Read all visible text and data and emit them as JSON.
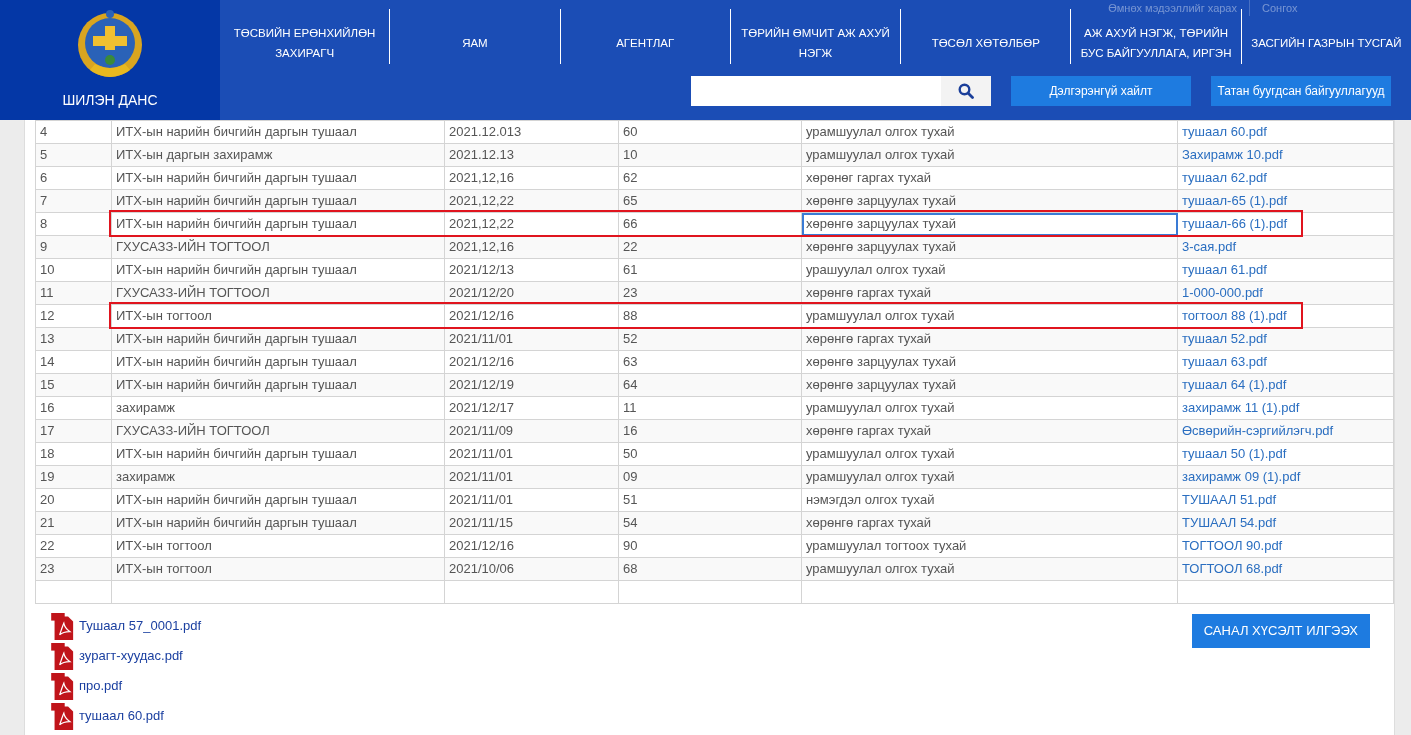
{
  "brand": {
    "title": "ШИЛЭН ДАНС"
  },
  "filter": {
    "label": "Өмнөх мэдээллийг харах",
    "select": "Сонгох"
  },
  "nav": [
    "ТӨСВИЙН ЕРӨНХИЙЛӨН ЗАХИРАГЧ",
    "ЯАМ",
    "АГЕНТЛАГ",
    "ТӨРИЙН ӨМЧИТ АЖ АХУЙ НЭГЖ",
    "ТӨСӨЛ ХӨТӨЛБӨР",
    "АЖ АХУЙ НЭГЖ, ТӨРИЙН БУС БАЙГУУЛЛАГА, ИРГЭН",
    "ЗАСГИЙН ГАЗРЫН ТУСГАЙ"
  ],
  "search": {
    "buttons": [
      "Дэлгэрэнгүй хайлт",
      "Татан буугдсан байгууллагууд"
    ]
  },
  "table": {
    "rows": [
      {
        "no": "4",
        "name": "ИТХ-ын нарийн бичгийн даргын тушаал",
        "date": "2021.12.013",
        "number": "60",
        "subject": "урамшуулал олгох тухай",
        "file": "тушаал 60.pdf",
        "marked": false,
        "focused": false
      },
      {
        "no": "5",
        "name": "ИТХ-ын даргын захирамж",
        "date": "2021.12.13",
        "number": "10",
        "subject": "урамшуулал олгох тухай",
        "file": "Захирамж 10.pdf",
        "marked": false,
        "focused": false
      },
      {
        "no": "6",
        "name": "ИТХ-ын нарийн бичгийн даргын тушаал",
        "date": "2021,12,16",
        "number": "62",
        "subject": "хөрөнөг гаргах тухай",
        "file": "тушаал 62.pdf",
        "marked": false,
        "focused": false
      },
      {
        "no": "7",
        "name": "ИТХ-ын нарийн бичгийн даргын тушаал",
        "date": "2021,12,22",
        "number": "65",
        "subject": "хөрөнгө зарцуулах тухай",
        "file": "тушаал-65 (1).pdf",
        "marked": false,
        "focused": false
      },
      {
        "no": "8",
        "name": "ИТХ-ын нарийн бичгийн даргын тушаал",
        "date": "2021,12,22",
        "number": "66",
        "subject": "хөрөнгө зарцуулах тухай",
        "file": "тушаал-66 (1).pdf",
        "marked": true,
        "focused": true
      },
      {
        "no": "9",
        "name": "ГХУСАЗЗ-ИЙН ТОГТООЛ",
        "date": "2021,12,16",
        "number": "22",
        "subject": "хөрөнгө зарцуулах тухай",
        "file": "3-сая.pdf",
        "marked": false,
        "focused": false
      },
      {
        "no": "10",
        "name": "ИТХ-ын нарийн бичгийн даргын тушаал",
        "date": "2021/12/13",
        "number": "61",
        "subject": "урашуулал олгох тухай",
        "file": "тушаал 61.pdf",
        "marked": false,
        "focused": false
      },
      {
        "no": "11",
        "name": "ГХУСАЗЗ-ИЙН ТОГТООЛ",
        "date": "2021/12/20",
        "number": "23",
        "subject": "хөрөнгө гаргах тухай",
        "file": "1-000-000.pdf",
        "marked": false,
        "focused": false
      },
      {
        "no": "12",
        "name": "ИТХ-ын тогтоол",
        "date": "2021/12/16",
        "number": "88",
        "subject": "урамшуулал олгох тухай",
        "file": "тогтоол 88 (1).pdf",
        "marked": true,
        "focused": false
      },
      {
        "no": "13",
        "name": "ИТХ-ын нарийн бичгийн даргын тушаал",
        "date": "2021/11/01",
        "number": "52",
        "subject": "хөрөнгө гаргах тухай",
        "file": "тушаал 52.pdf",
        "marked": false,
        "focused": false
      },
      {
        "no": "14",
        "name": "ИТХ-ын нарийн бичгийн даргын тушаал",
        "date": "2021/12/16",
        "number": "63",
        "subject": "хөрөнгө зарцуулах тухай",
        "file": "тушаал 63.pdf",
        "marked": false,
        "focused": false
      },
      {
        "no": "15",
        "name": "ИТХ-ын нарийн бичгийн даргын тушаал",
        "date": "2021/12/19",
        "number": "64",
        "subject": "хөрөнгө зарцуулах тухай",
        "file": "тушаал 64 (1).pdf",
        "marked": false,
        "focused": false
      },
      {
        "no": "16",
        "name": "захирамж",
        "date": "2021/12/17",
        "number": "11",
        "subject": "урамшуулал олгох тухай",
        "file": "захирамж 11 (1).pdf",
        "marked": false,
        "focused": false
      },
      {
        "no": "17",
        "name": "ГХУСАЗЗ-ИЙН ТОГТООЛ",
        "date": "2021/11/09",
        "number": "16",
        "subject": "хөрөнгө гаргах тухай",
        "file": "Өсвөрийн-сэргийлэгч.pdf",
        "marked": false,
        "focused": false
      },
      {
        "no": "18",
        "name": "ИТХ-ын нарийн бичгийн даргын тушаал",
        "date": "2021/11/01",
        "number": "50",
        "subject": "урамшуулал олгох тухай",
        "file": "тушаал 50 (1).pdf",
        "marked": false,
        "focused": false
      },
      {
        "no": "19",
        "name": "захирамж",
        "date": "2021/11/01",
        "number": "09",
        "subject": "урамшуулал олгох тухай",
        "file": "захирамж 09 (1).pdf",
        "marked": false,
        "focused": false
      },
      {
        "no": "20",
        "name": "ИТХ-ын нарийн бичгийн даргын тушаал",
        "date": "2021/11/01",
        "number": "51",
        "subject": "нэмэгдэл олгох тухай",
        "file": "ТУШААЛ 51.pdf",
        "marked": false,
        "focused": false
      },
      {
        "no": "21",
        "name": "ИТХ-ын нарийн бичгийн даргын тушаал",
        "date": "2021/11/15",
        "number": "54",
        "subject": "хөрөнгө гаргах тухай",
        "file": "ТУШААЛ 54.pdf",
        "marked": false,
        "focused": false
      },
      {
        "no": "22",
        "name": "ИТХ-ын тогтоол",
        "date": "2021/12/16",
        "number": "90",
        "subject": "урамшуулал тогтоох тухай",
        "file": "ТОГТООЛ 90.pdf",
        "marked": false,
        "focused": false
      },
      {
        "no": "23",
        "name": "ИТХ-ын тогтоол",
        "date": "2021/10/06",
        "number": "68",
        "subject": "урамшуулал олгох тухай",
        "file": "ТОГТООЛ 68.pdf",
        "marked": false,
        "focused": false
      }
    ]
  },
  "attachments": [
    "Тушаал 57_0001.pdf",
    "зурагт-хуудас.pdf",
    "про.pdf",
    "тушаал 60.pdf"
  ],
  "feedback_button": "САНАЛ ХҮСЭЛТ ИЛГЭЭХ"
}
